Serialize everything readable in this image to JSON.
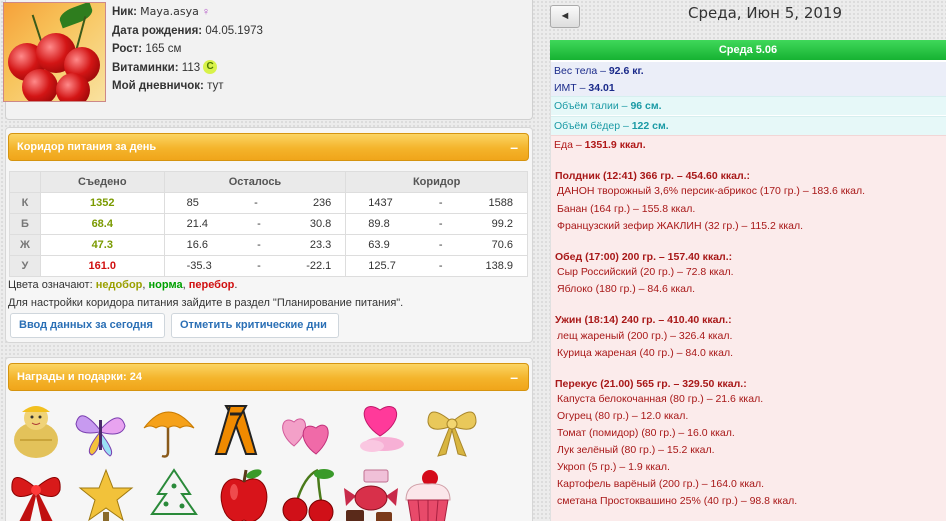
{
  "profile": {
    "nick_label": "Ник:",
    "nick_value": "Maya.asya",
    "birth_label": "Дата рождения:",
    "birth_value": "04.05.1973",
    "height_label": "Рост:",
    "height_value": "165 см",
    "vitamins_label": "Витаминки:",
    "vitamins_value": "113",
    "vitamins_badge": "C",
    "diary_label": "Мой дневничок:",
    "diary_value": "тут"
  },
  "corridor": {
    "title": "Коридор питания за день",
    "collapse": "–",
    "headers": {
      "eaten": "Съедено",
      "left": "Осталось",
      "corridor": "Коридор"
    },
    "rows": [
      {
        "label": "К",
        "eaten": "1352",
        "left_from": "85",
        "left_to": "236",
        "corr_from": "1437",
        "corr_to": "1588",
        "color": "green"
      },
      {
        "label": "Б",
        "eaten": "68.4",
        "left_from": "21.4",
        "left_to": "30.8",
        "corr_from": "89.8",
        "corr_to": "99.2",
        "color": "green"
      },
      {
        "label": "Ж",
        "eaten": "47.3",
        "left_from": "16.6",
        "left_to": "23.3",
        "corr_from": "63.9",
        "corr_to": "70.6",
        "color": "green"
      },
      {
        "label": "У",
        "eaten": "161.0",
        "left_from": "-35.3",
        "left_to": "-22.1",
        "corr_from": "125.7",
        "corr_to": "138.9",
        "color": "red"
      }
    ],
    "dash": "-",
    "legend_prefix": "Цвета означают:",
    "legend_under": "недобор",
    "legend_norm": "норма",
    "legend_over": "перебор",
    "comma": ",",
    "dot": ".",
    "settings_text": "Для настройки коридора питания зайдите в раздел \"Планирование питания\".",
    "btn_enter": "Ввод данных за сегодня",
    "btn_critical": "Отметить критические дни"
  },
  "gifts": {
    "title": "Награды и подарки: 24",
    "collapse": "–",
    "icons": [
      "straw-doll-icon",
      "butterfly-icon",
      "umbrella-icon",
      "ribbon-icon",
      "two-hearts-icon",
      "heart-gift-icon",
      "gold-bow-icon",
      "red-bow-icon",
      "gold-star-icon",
      "christmas-tree-icon",
      "apple-icon",
      "cherries-icon",
      "candy-icon",
      "cupcake-icon"
    ]
  },
  "diary": {
    "back": "◄",
    "date_title": "Среда, Июн 5, 2019",
    "day_label": "Среда 5.06",
    "weight_label": "Вес тела –",
    "weight_value": "92.6 кг.",
    "bmi_label": "ИМТ –",
    "bmi_value": "34.01",
    "waist_label": "Объём талии –",
    "waist_value": "96 см.",
    "hips_label": "Объём бёдер –",
    "hips_value": "122 см.",
    "food_label": "Еда –",
    "food_value": "1351.9 ккал.",
    "meals": [
      {
        "head": "Полдник (12:41) 366 гр. – 454.60 ккал.:",
        "items": [
          "ДАНОН творожный 3,6% персик-абрикос (170 гр.) – 183.6 ккал.",
          "Банан (164 гр.) – 155.8 ккал.",
          "Французский зефир ЖАКЛИН (32 гр.) – 115.2 ккал."
        ]
      },
      {
        "head": "Обед (17:00) 200 гр. – 157.40 ккал.:",
        "items": [
          "Сыр Российский (20 гр.) – 72.8 ккал.",
          "Яблоко (180 гр.) – 84.6 ккал."
        ]
      },
      {
        "head": "Ужин (18:14) 240 гр. – 410.40 ккал.:",
        "items": [
          "лещ жареный (200 гр.) – 326.4 ккал.",
          "Курица жареная (40 гр.) – 84.0 ккал."
        ]
      },
      {
        "head": "Перекус (21.00) 565 гр. – 329.50 ккал.:",
        "items": [
          "Капуста белокочанная (80 гр.) – 21.6 ккал.",
          "Огурец (80 гр.) – 12.0 ккал.",
          "Томат (помидор) (80 гр.) – 16.0 ккал.",
          "Лук зелёный (80 гр.) – 15.2 ккал.",
          "Укроп (5 гр.) – 1.9 ккал.",
          "Картофель варёный (200 гр.) – 164.0 ккал.",
          "сметана Простоквашино 25% (40 гр.) – 98.8 ккал."
        ]
      }
    ]
  }
}
